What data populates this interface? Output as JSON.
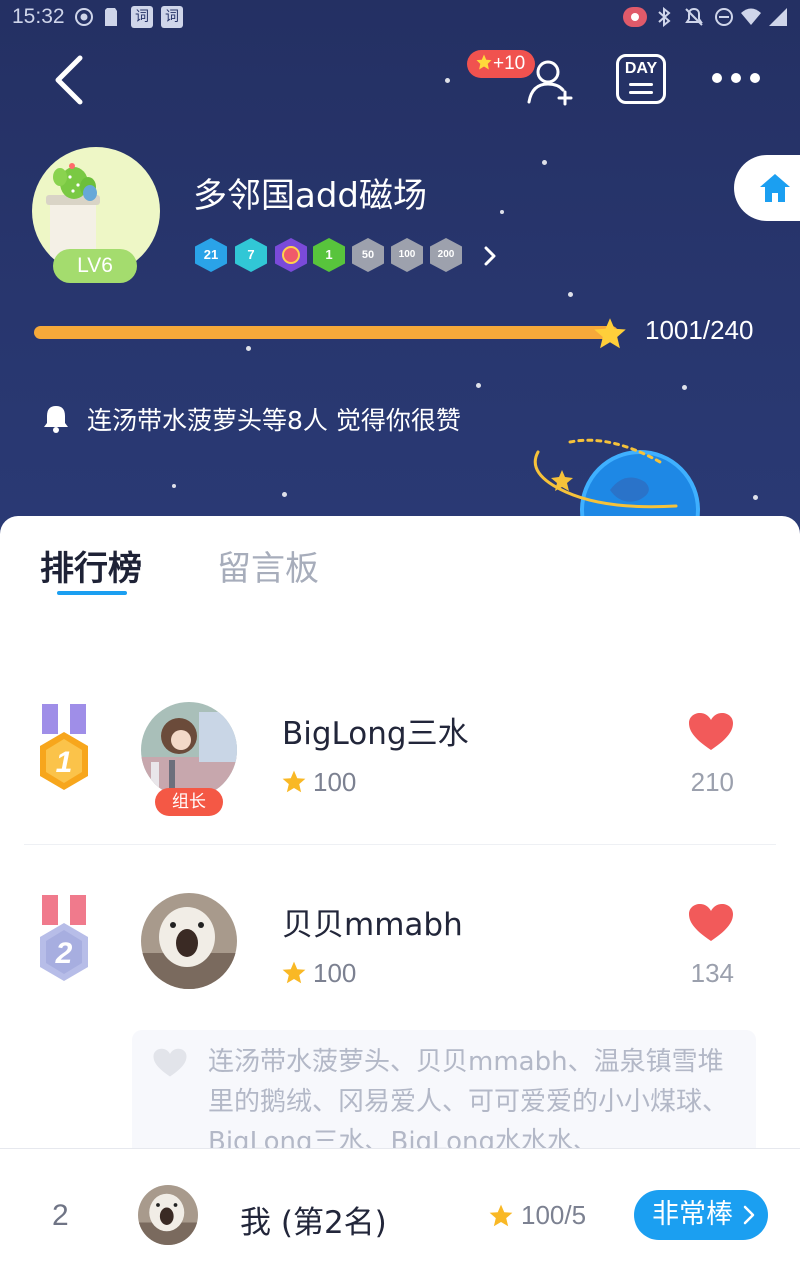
{
  "status_bar": {
    "time": "15:32",
    "app_icon_labels": [
      "词",
      "词"
    ]
  },
  "header": {
    "reward_badge": "+10"
  },
  "group": {
    "name": "多邻国add磁场",
    "level": "LV6",
    "medals": [
      "21",
      "7",
      "",
      "1",
      "50",
      "100",
      "200"
    ],
    "progress_text": "1001/240",
    "notice": "连汤带水菠萝头等8人 觉得你很赞"
  },
  "tabs": {
    "ranking": "排行榜",
    "message_board": "留言板"
  },
  "ranking": [
    {
      "rank": "1",
      "name": "BigLong三水",
      "tag": "组长",
      "score": "100",
      "likes": "210"
    },
    {
      "rank": "2",
      "name": "贝贝mmabh",
      "tag": "",
      "score": "100",
      "likes": "134"
    }
  ],
  "likers_text": "连汤带水菠萝头、贝贝mmabh、温泉镇雪堆里的鹅绒、冈易爱人、可可爱爱的小小煤球、BigLong三水、BigLong水水水、",
  "me": {
    "rank": "2",
    "label": "我 (第2名)",
    "score": "100/5",
    "cheer_button": "非常棒"
  },
  "colors": {
    "hero_bg": "#263368",
    "accent_blue": "#1b9ff1",
    "progress": "#f6a93a",
    "heart_red": "#f25a5a",
    "level_green": "#a4dc6e",
    "leader_red": "#f45845"
  },
  "icons": [
    "back-arrow-icon",
    "add-user-icon",
    "day-calendar-icon",
    "more-icon",
    "home-icon",
    "bell-icon",
    "star-icon",
    "heart-icon",
    "gold-medal-icon",
    "silver-medal-icon",
    "chevron-right-icon"
  ]
}
